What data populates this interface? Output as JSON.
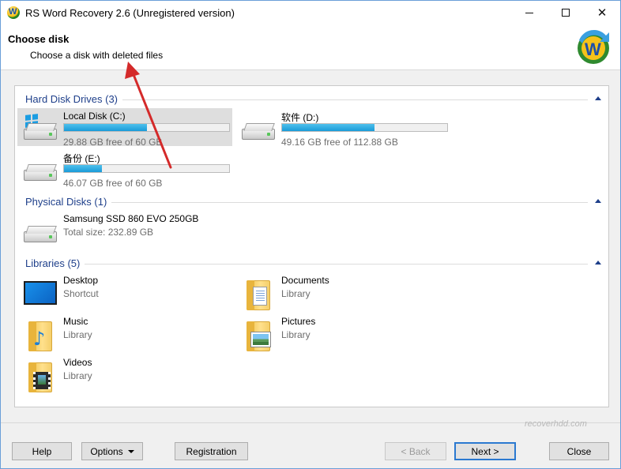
{
  "window": {
    "title": "RS Word Recovery 2.6 (Unregistered version)",
    "min_symbol": "—",
    "close_symbol": "✕"
  },
  "header": {
    "title": "Choose disk",
    "subtitle": "Choose a disk with deleted files",
    "logo_letter": "W"
  },
  "sections": {
    "hard_disks": {
      "title": "Hard Disk Drives (3)",
      "items": [
        {
          "name": "Local Disk (C:)",
          "free": "29.88 GB free of 60 GB",
          "used_fraction": 0.5,
          "selected": true
        },
        {
          "name": "软件 (D:)",
          "free": "49.16 GB free of 112.88 GB",
          "used_fraction": 0.56,
          "selected": false
        },
        {
          "name": "备份 (E:)",
          "free": "46.07 GB free of 60 GB",
          "used_fraction": 0.23,
          "selected": false
        }
      ]
    },
    "physical_disks": {
      "title": "Physical Disks (1)",
      "items": [
        {
          "name": "Samsung SSD 860 EVO 250GB",
          "detail": "Total size: 232.89 GB"
        }
      ]
    },
    "libraries": {
      "title": "Libraries (5)",
      "items": [
        {
          "name": "Desktop",
          "detail": "Shortcut",
          "icon": "desktop-icon"
        },
        {
          "name": "Documents",
          "detail": "Library",
          "icon": "documents-folder-icon"
        },
        {
          "name": "Music",
          "detail": "Library",
          "icon": "music-folder-icon"
        },
        {
          "name": "Pictures",
          "detail": "Library",
          "icon": "pictures-folder-icon"
        },
        {
          "name": "Videos",
          "detail": "Library",
          "icon": "videos-folder-icon"
        }
      ]
    }
  },
  "buttons": {
    "help": "Help",
    "options": "Options",
    "registration": "Registration",
    "back": "< Back",
    "next": "Next >",
    "close": "Close"
  },
  "watermark": {
    "text": "recoverhdd.com"
  },
  "colors": {
    "accent": "#1e3f8a",
    "bar_fill": "#1a9bd8",
    "arrow": "#d42a2a",
    "default_button_border": "#2b79d0"
  }
}
